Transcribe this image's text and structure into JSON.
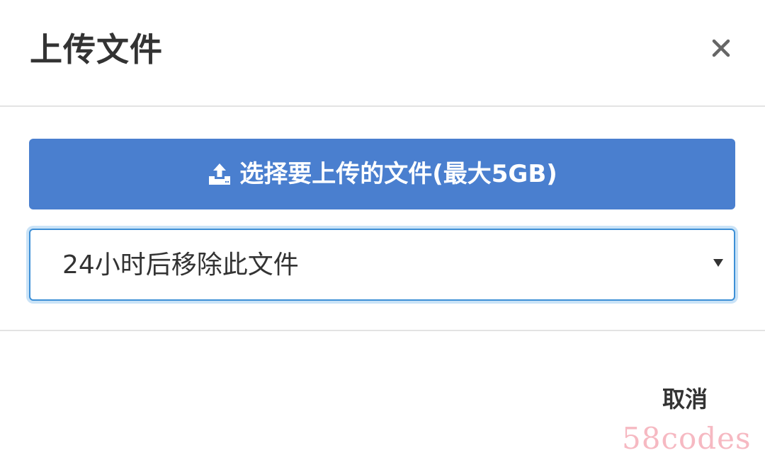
{
  "dialog": {
    "title": "上传文件",
    "close_icon": "close-icon"
  },
  "upload": {
    "icon": "upload-icon",
    "label": "选择要上传的文件(最大5GB)",
    "accent_color": "#4a7fcf"
  },
  "expiry_select": {
    "selected": "24小时后移除此文件",
    "arrow_icon": "caret-down-icon",
    "focus_color": "#3d8fd6"
  },
  "footer": {
    "cancel_label": "取消"
  },
  "watermark": {
    "text": "58codes",
    "color": "#f6b9c2"
  }
}
